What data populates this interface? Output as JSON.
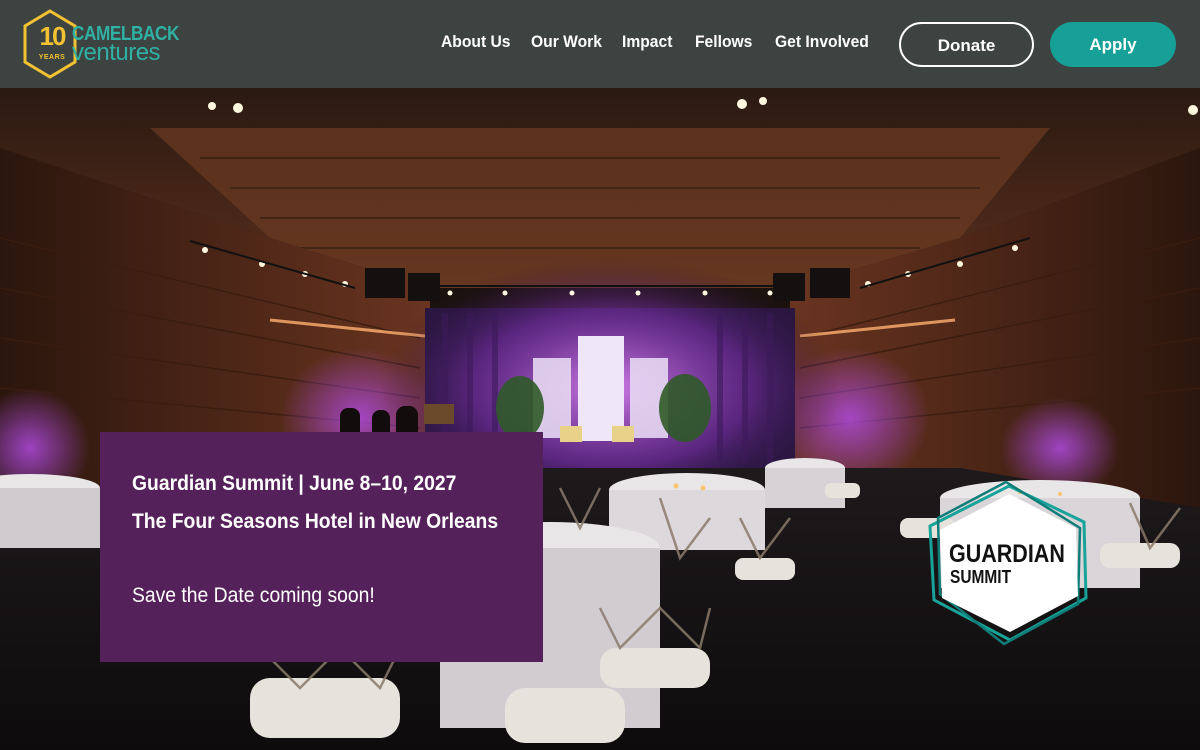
{
  "header": {
    "logo": {
      "number": "10",
      "years": "YEARS",
      "name_top": "CAMELBACK",
      "name_bottom": "ventures"
    },
    "nav": [
      {
        "label": "About Us"
      },
      {
        "label": "Our Work"
      },
      {
        "label": "Impact"
      },
      {
        "label": "Fellows"
      },
      {
        "label": "Get Involved"
      }
    ],
    "donate_label": "Donate",
    "apply_label": "Apply"
  },
  "hero": {
    "event_line": "Guardian Summit | June 8–10, 2027",
    "venue_line": "The Four Seasons Hotel in New Orleans",
    "save_date": "Save the Date coming soon!",
    "badge": {
      "title": "GUARDIAN",
      "subtitle": "SUMMIT"
    }
  },
  "colors": {
    "header_bg": "#3d4341",
    "accent_teal": "#16a097",
    "logo_gold": "#f2c232",
    "info_box": "#55215a",
    "stage_light": "#c060e8"
  }
}
